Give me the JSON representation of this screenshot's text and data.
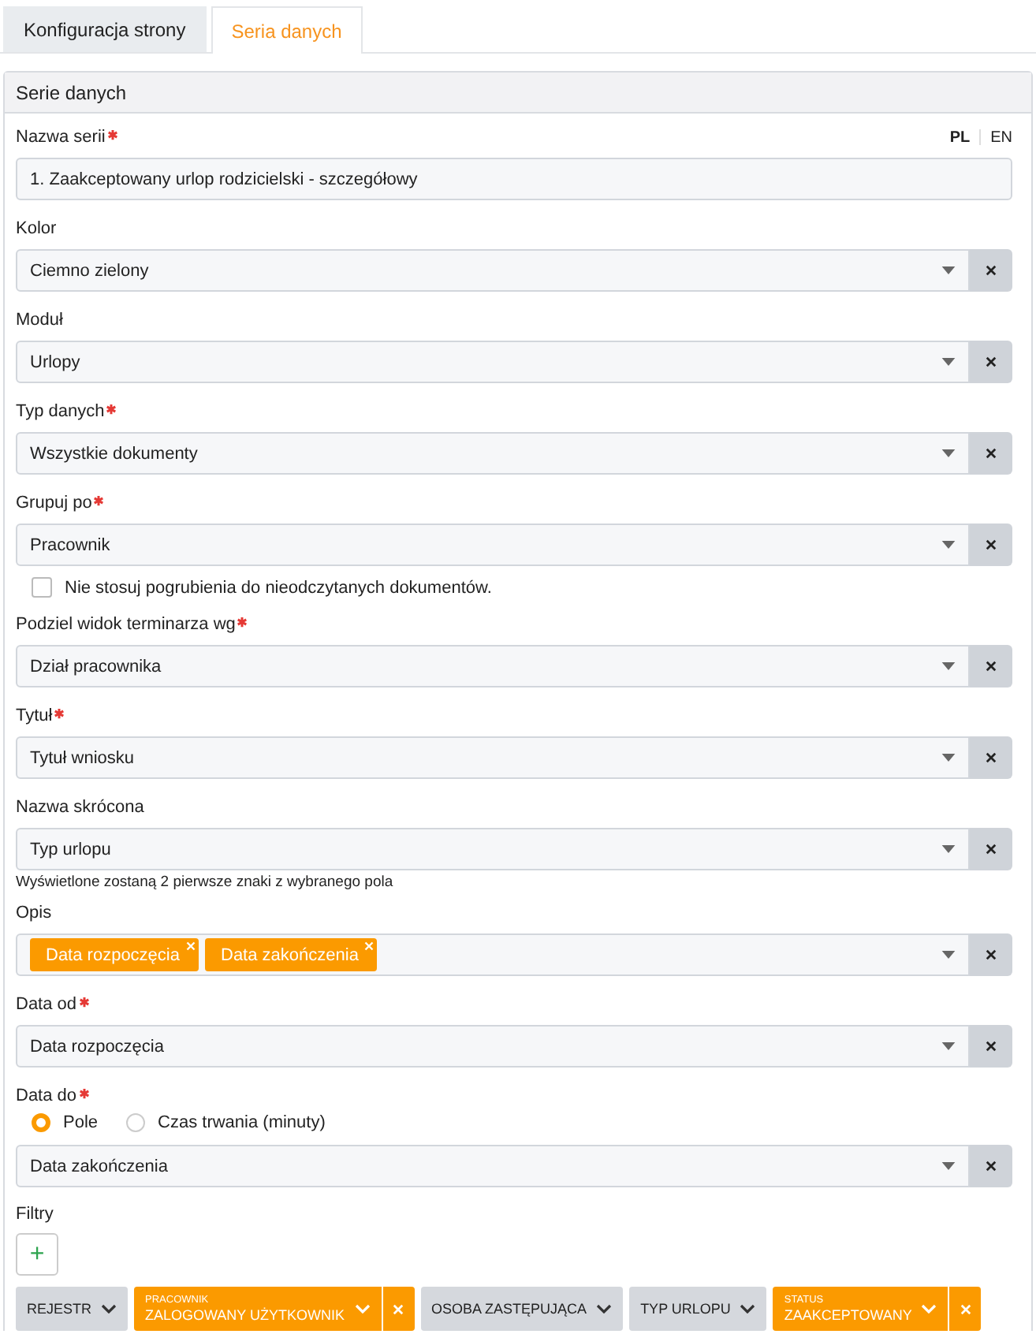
{
  "tabs": [
    {
      "label": "Konfiguracja strony",
      "selected": false
    },
    {
      "label": "Seria danych",
      "selected": true
    }
  ],
  "panel": {
    "title": "Serie danych"
  },
  "languages": [
    {
      "label": "PL",
      "selected": true
    },
    {
      "label": "EN",
      "selected": false
    }
  ],
  "fields": [
    {
      "kind": "text",
      "label": "Nazwa serii",
      "required": true,
      "value": "1. Zaakceptowany urlop rodzicielski - szczegółowy"
    },
    {
      "kind": "select",
      "label": "Kolor",
      "required": false,
      "value": "Ciemno zielony"
    },
    {
      "kind": "select",
      "label": "Moduł",
      "required": false,
      "value": "Urlopy"
    },
    {
      "kind": "select",
      "label": "Typ danych",
      "required": true,
      "value": "Wszystkie dokumenty"
    },
    {
      "kind": "select",
      "label": "Grupuj po",
      "required": true,
      "value": "Pracownik"
    },
    {
      "kind": "checkbox",
      "label": "Nie stosuj pogrubienia do nieodczytanych dokumentów.",
      "checked": false
    },
    {
      "kind": "select",
      "label": "Podziel widok terminarza wg",
      "required": true,
      "value": "Dział pracownika"
    },
    {
      "kind": "select",
      "label": "Tytuł",
      "required": true,
      "value": "Tytuł wniosku"
    },
    {
      "kind": "select",
      "label": "Nazwa skrócona",
      "required": false,
      "value": "Typ urlopu",
      "hint": "Wyświetlone zostaną 2 pierwsze znaki z wybranego pola"
    },
    {
      "kind": "tags",
      "label": "Opis",
      "required": false,
      "tags": [
        "Data rozpoczęcia",
        "Data zakończenia"
      ]
    },
    {
      "kind": "select",
      "label": "Data od",
      "required": true,
      "value": "Data rozpoczęcia"
    },
    {
      "kind": "select",
      "label": "Data do",
      "required": true,
      "value": "Data zakończenia",
      "options": [
        {
          "label": "Pole",
          "selected": true
        },
        {
          "label": "Czas trwania (minuty)",
          "selected": false
        }
      ]
    }
  ],
  "filters_section": {
    "label": "Filtry",
    "add_button": "+"
  },
  "filters": [
    {
      "label": "REJESTR",
      "active": false
    },
    {
      "label": "PRACOWNIK",
      "value": "ZALOGOWANY UŻYTKOWNIK",
      "active": true
    },
    {
      "label": "OSOBA ZASTĘPUJĄCA",
      "active": false
    },
    {
      "label": "TYP URLOPU",
      "active": false
    },
    {
      "label": "STATUS",
      "value": "ZAAKCEPTOWANY",
      "active": true
    }
  ]
}
